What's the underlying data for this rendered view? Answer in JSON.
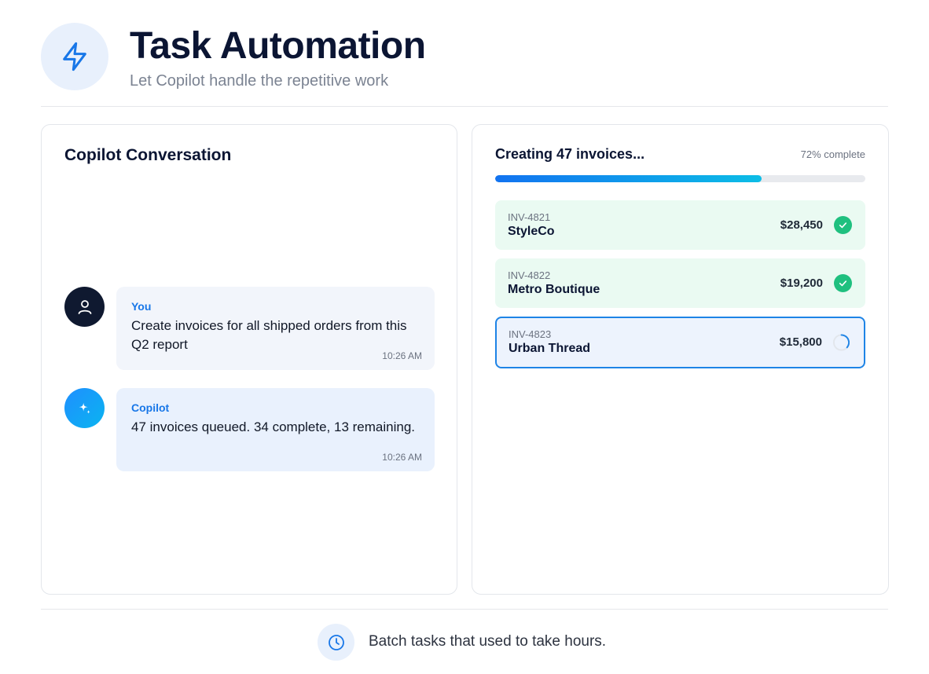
{
  "header": {
    "icon": "lightning-bolt-icon",
    "title": "Task Automation",
    "subtitle": "Let Copilot handle the repetitive work"
  },
  "conversation": {
    "title": "Copilot Conversation",
    "messages": [
      {
        "sender": "You",
        "avatar_icon": "user-icon",
        "text": "Create invoices for all shipped orders from this Q2 report",
        "time": "10:26 AM"
      },
      {
        "sender": "Copilot",
        "avatar_icon": "sparkle-icon",
        "text": "47 invoices queued. 34 complete, 13 remaining.",
        "time": "10:26 AM"
      }
    ]
  },
  "progress": {
    "title": "Creating 47 invoices...",
    "percent_label": "72% complete",
    "percent": 72,
    "invoices": [
      {
        "id": "INV-4821",
        "name": "StyleCo",
        "amount": "$28,450",
        "status": "complete",
        "status_icon": "check-icon"
      },
      {
        "id": "INV-4822",
        "name": "Metro Boutique",
        "amount": "$19,200",
        "status": "complete",
        "status_icon": "check-icon"
      },
      {
        "id": "INV-4823",
        "name": "Urban Thread",
        "amount": "$15,800",
        "status": "in-progress",
        "status_icon": "spinner-icon"
      }
    ]
  },
  "footer": {
    "icon": "clock-icon",
    "text": "Batch tasks that used to take hours."
  },
  "colors": {
    "accent": "#1877e8",
    "success": "#1fc07f",
    "navy": "#0b1533"
  }
}
